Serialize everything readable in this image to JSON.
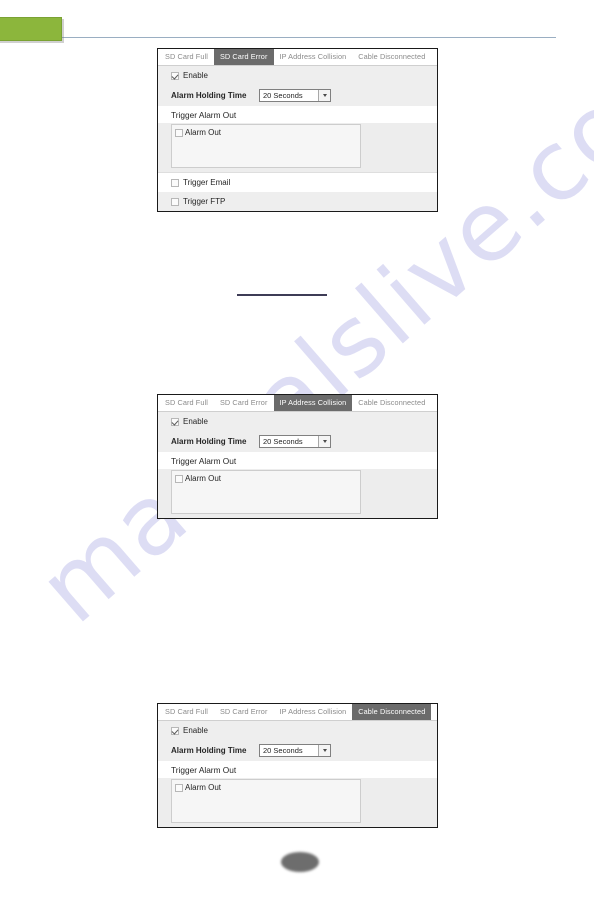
{
  "document": {
    "brand_mark": "green-brand-block",
    "watermark": "manualslive.com",
    "page_badge": ""
  },
  "common": {
    "tabs": [
      "SD Card Full",
      "SD Card Error",
      "IP Address Collision",
      "Cable Disconnected"
    ],
    "enable_label": "Enable",
    "alarm_holding_time_label": "Alarm Holding Time",
    "alarm_holding_time_value": "20 Seconds",
    "trigger_alarm_out_label": "Trigger Alarm Out",
    "alarm_out_label": "Alarm Out",
    "trigger_email_label": "Trigger Email",
    "trigger_ftp_label": "Trigger FTP"
  },
  "colors": {
    "active_tab_bg": "#6b6b6b",
    "active_tab_fg": "#ffffff",
    "inactive_tab_fg": "#8a8a8a",
    "row_shaded": "#eeeeee",
    "panel_border": "#1a1a1a",
    "brand_green": "#8cb63c",
    "header_rule": "#9aaec2",
    "mid_rule": "#3e3c56",
    "watermark": "#c9c9ee"
  },
  "panels": [
    {
      "id": "sd-card-error",
      "active_tab": "SD Card Error",
      "active_tab_index": 1,
      "tabs": [
        "SD Card Full",
        "SD Card Error",
        "IP Address Collision",
        "Cable Disconnected"
      ],
      "enable_label": "Enable",
      "enable_checked": true,
      "alarm_holding_time_label": "Alarm Holding Time",
      "alarm_holding_time_value": "20 Seconds",
      "trigger_alarm_out_label": "Trigger Alarm Out",
      "alarm_out_label": "Alarm Out",
      "alarm_out_checked": false,
      "trigger_email_label": "Trigger Email",
      "trigger_email_checked": false,
      "trigger_ftp_label": "Trigger FTP",
      "trigger_ftp_checked": false,
      "has_trigger_email": true,
      "has_trigger_ftp": true
    },
    {
      "id": "ip-address-collision",
      "active_tab": "IP Address Collision",
      "active_tab_index": 2,
      "tabs": [
        "SD Card Full",
        "SD Card Error",
        "IP Address Collision",
        "Cable Disconnected"
      ],
      "enable_label": "Enable",
      "enable_checked": true,
      "alarm_holding_time_label": "Alarm Holding Time",
      "alarm_holding_time_value": "20 Seconds",
      "trigger_alarm_out_label": "Trigger Alarm Out",
      "alarm_out_label": "Alarm Out",
      "alarm_out_checked": false,
      "has_trigger_email": false,
      "has_trigger_ftp": false
    },
    {
      "id": "cable-disconnected",
      "active_tab": "Cable Disconnected",
      "active_tab_index": 3,
      "tabs": [
        "SD Card Full",
        "SD Card Error",
        "IP Address Collision",
        "Cable Disconnected"
      ],
      "enable_label": "Enable",
      "enable_checked": true,
      "alarm_holding_time_label": "Alarm Holding Time",
      "alarm_holding_time_value": "20 Seconds",
      "trigger_alarm_out_label": "Trigger Alarm Out",
      "alarm_out_label": "Alarm Out",
      "alarm_out_checked": false,
      "has_trigger_email": false,
      "has_trigger_ftp": false
    }
  ]
}
